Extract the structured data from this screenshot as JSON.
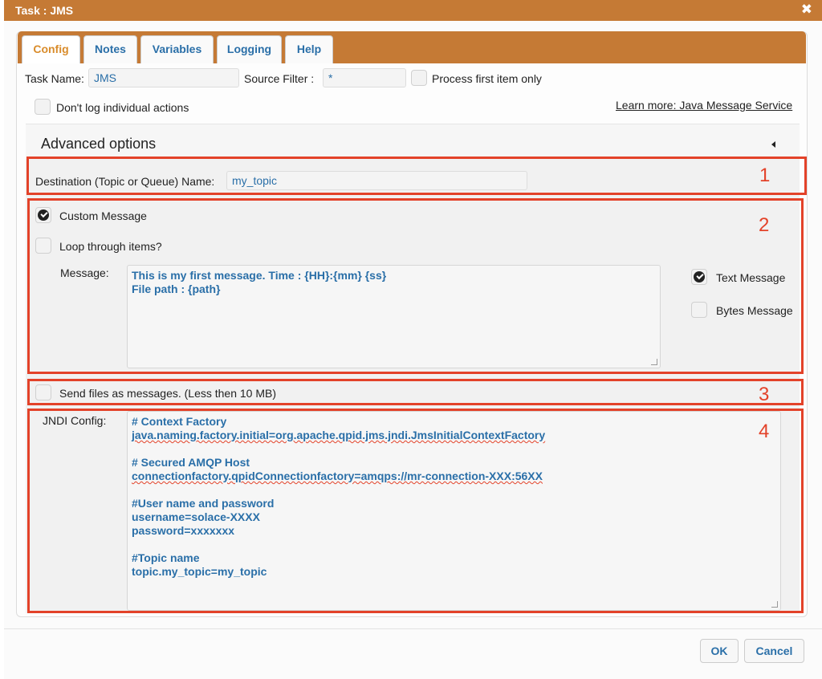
{
  "window": {
    "title": "Task : JMS",
    "close_symbol": "✖"
  },
  "tabs": [
    {
      "label": "Config",
      "active": true
    },
    {
      "label": "Notes"
    },
    {
      "label": "Variables"
    },
    {
      "label": "Logging"
    },
    {
      "label": "Help"
    }
  ],
  "config": {
    "task_name_label": "Task Name:",
    "task_name_value": "JMS",
    "source_filter_label": "Source Filter :",
    "source_filter_value": "*",
    "process_first_label": "Process first item only",
    "process_first_checked": false,
    "dont_log_label": "Don't log individual actions",
    "dont_log_checked": false,
    "learn_more_link": "Learn more: Java Message Service"
  },
  "advanced": {
    "title": "Advanced options",
    "destination_label": "Destination (Topic or Queue) Name:",
    "destination_value": "my_topic",
    "custom_message_label": "Custom Message",
    "custom_message_checked": true,
    "loop_items_label": "Loop through items?",
    "loop_items_checked": false,
    "message_label": "Message:",
    "message_lines": [
      "This is my first message. Time : {HH}:{mm} {ss}",
      "File path : {path}"
    ],
    "text_message_label": "Text Message",
    "text_message_checked": true,
    "bytes_message_label": "Bytes Message",
    "bytes_message_checked": false,
    "send_files_label": "Send files as messages. (Less then 10 MB)",
    "send_files_checked": false,
    "jndi_label": "JNDI Config:",
    "jndi_lines": [
      "# Context Factory",
      "java.naming.factory.initial=org.apache.qpid.jms.jndi.JmsInitialContextFactory",
      "",
      "# Secured AMQP Host",
      "connectionfactory.qpidConnectionfactory=amqps://mr-connection-XXX:56XX",
      "",
      "#User name and password",
      "username=solace-XXXX",
      "password=xxxxxxx",
      "",
      "#Topic name",
      "topic.my_topic=my_topic"
    ]
  },
  "annotations": [
    "1",
    "2",
    "3",
    "4"
  ],
  "footer": {
    "ok_label": "OK",
    "cancel_label": "Cancel"
  },
  "colors": {
    "accent": "#c57a35",
    "annotation": "#e34229",
    "value_text": "#2a6fa8"
  }
}
